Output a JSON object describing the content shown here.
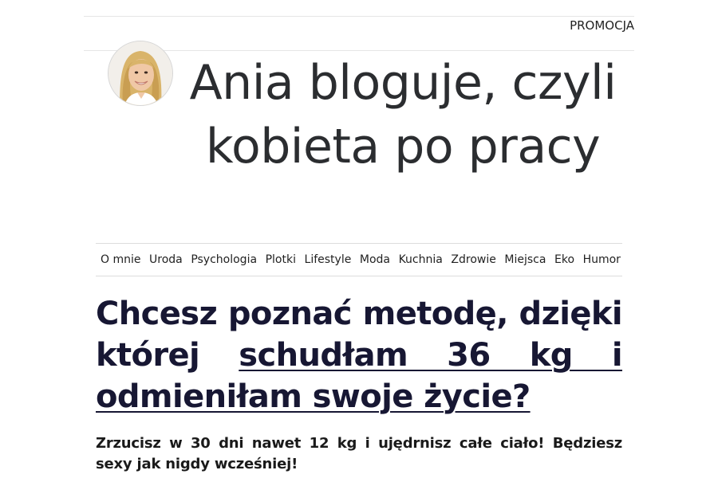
{
  "header": {
    "promo_link": "PROMOCJA",
    "site_title": "Ania bloguje, czyli kobieta po pracy"
  },
  "nav": {
    "items": [
      {
        "label": "O mnie"
      },
      {
        "label": "Uroda"
      },
      {
        "label": "Psychologia"
      },
      {
        "label": "Plotki"
      },
      {
        "label": "Lifestyle"
      },
      {
        "label": "Moda"
      },
      {
        "label": "Kuchnia"
      },
      {
        "label": "Zdrowie"
      },
      {
        "label": "Miejsca"
      },
      {
        "label": "Eko"
      },
      {
        "label": "Humor"
      }
    ]
  },
  "article": {
    "headline_part1": "Chcesz poznać metodę, dzięki której ",
    "headline_link": "schudłam 36 kg i odmieniłam swoje życie?",
    "lead": "Zrzucisz w 30 dni nawet 12 kg i ujędrnisz całe ciało! Będziesz sexy jak nigdy wcześniej!"
  },
  "colors": {
    "headline": "#171733",
    "title": "#2b2d30",
    "divider": "#dcdcdc"
  },
  "icons": {
    "avatar": "author-photo"
  }
}
